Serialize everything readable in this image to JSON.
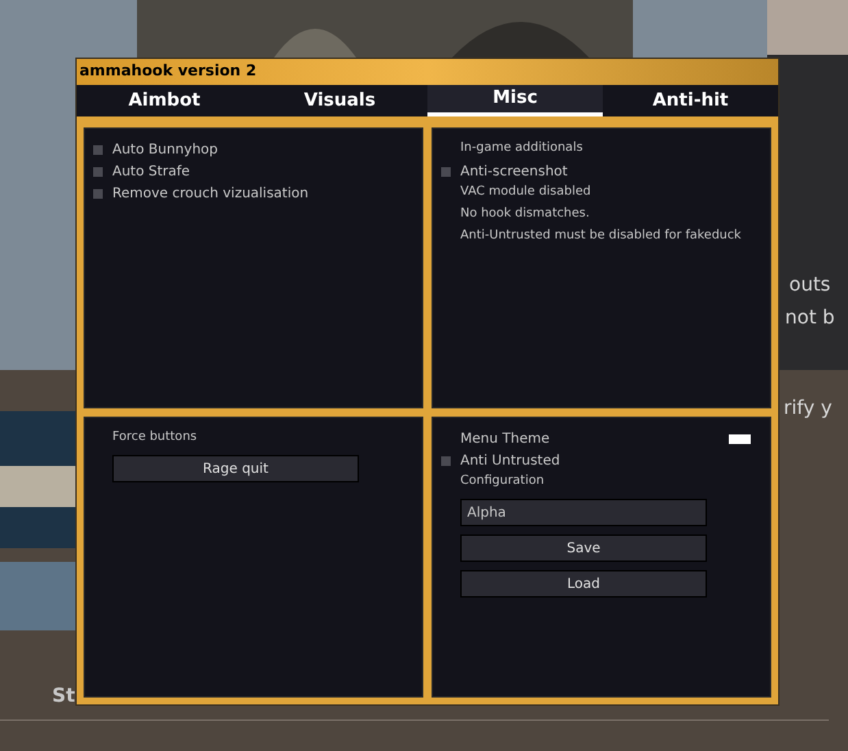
{
  "background": {
    "texts": [
      {
        "text": "outs",
        "kind": "line1"
      },
      {
        "text": "not b",
        "kind": "line2"
      },
      {
        "text": "rify y",
        "kind": "line3"
      },
      {
        "text": "St",
        "kind": "tab2"
      }
    ]
  },
  "window": {
    "title": "ammahook version 2"
  },
  "tabs": [
    {
      "label": "Aimbot",
      "selected": false
    },
    {
      "label": "Visuals",
      "selected": false
    },
    {
      "label": "Misc",
      "selected": true
    },
    {
      "label": "Anti-hit",
      "selected": false
    }
  ],
  "panels": [
    {
      "items": [
        {
          "kind": "checkbox",
          "label": "Auto Bunnyhop",
          "checked": false
        },
        {
          "kind": "checkbox",
          "label": "Auto Strafe",
          "checked": false
        },
        {
          "kind": "checkbox",
          "label": "Remove crouch vizualisation",
          "checked": false
        }
      ]
    },
    {
      "items": [
        {
          "kind": "label",
          "label": "In-game additionals"
        },
        {
          "kind": "checkbox",
          "label": "Anti-screenshot",
          "checked": false
        },
        {
          "kind": "label",
          "label": "VAC module disabled"
        },
        {
          "kind": "label",
          "label": "No hook dismatches."
        },
        {
          "kind": "label",
          "label": "Anti-Untrusted must be disabled for fakeduck"
        }
      ]
    },
    {
      "items": [
        {
          "kind": "label",
          "label": "Force buttons"
        },
        {
          "kind": "button",
          "label": "Rage quit"
        }
      ]
    },
    {
      "items": [
        {
          "kind": "color",
          "label": "Menu Theme",
          "color": "#ffffff"
        },
        {
          "kind": "checkbox",
          "label": "Anti Untrusted",
          "checked": false
        },
        {
          "kind": "label",
          "label": "Configuration"
        },
        {
          "kind": "field",
          "value": "Alpha"
        },
        {
          "kind": "button",
          "label": "Save"
        },
        {
          "kind": "button",
          "label": "Load"
        }
      ]
    }
  ]
}
